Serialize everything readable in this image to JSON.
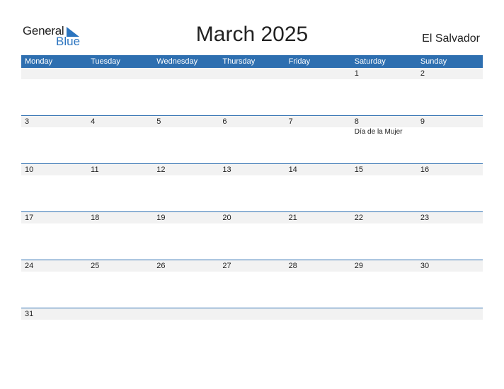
{
  "logo": {
    "general": "General",
    "blue": "Blue"
  },
  "title": "March 2025",
  "country": "El Salvador",
  "weekdays": [
    "Monday",
    "Tuesday",
    "Wednesday",
    "Thursday",
    "Friday",
    "Saturday",
    "Sunday"
  ],
  "weeks": [
    [
      {
        "d": ""
      },
      {
        "d": ""
      },
      {
        "d": ""
      },
      {
        "d": ""
      },
      {
        "d": ""
      },
      {
        "d": "1"
      },
      {
        "d": "2"
      }
    ],
    [
      {
        "d": "3"
      },
      {
        "d": "4"
      },
      {
        "d": "5"
      },
      {
        "d": "6"
      },
      {
        "d": "7"
      },
      {
        "d": "8",
        "h": "Día de la Mujer"
      },
      {
        "d": "9"
      }
    ],
    [
      {
        "d": "10"
      },
      {
        "d": "11"
      },
      {
        "d": "12"
      },
      {
        "d": "13"
      },
      {
        "d": "14"
      },
      {
        "d": "15"
      },
      {
        "d": "16"
      }
    ],
    [
      {
        "d": "17"
      },
      {
        "d": "18"
      },
      {
        "d": "19"
      },
      {
        "d": "20"
      },
      {
        "d": "21"
      },
      {
        "d": "22"
      },
      {
        "d": "23"
      }
    ],
    [
      {
        "d": "24"
      },
      {
        "d": "25"
      },
      {
        "d": "26"
      },
      {
        "d": "27"
      },
      {
        "d": "28"
      },
      {
        "d": "29"
      },
      {
        "d": "30"
      }
    ],
    [
      {
        "d": "31"
      },
      {
        "d": ""
      },
      {
        "d": ""
      },
      {
        "d": ""
      },
      {
        "d": ""
      },
      {
        "d": ""
      },
      {
        "d": ""
      }
    ]
  ]
}
